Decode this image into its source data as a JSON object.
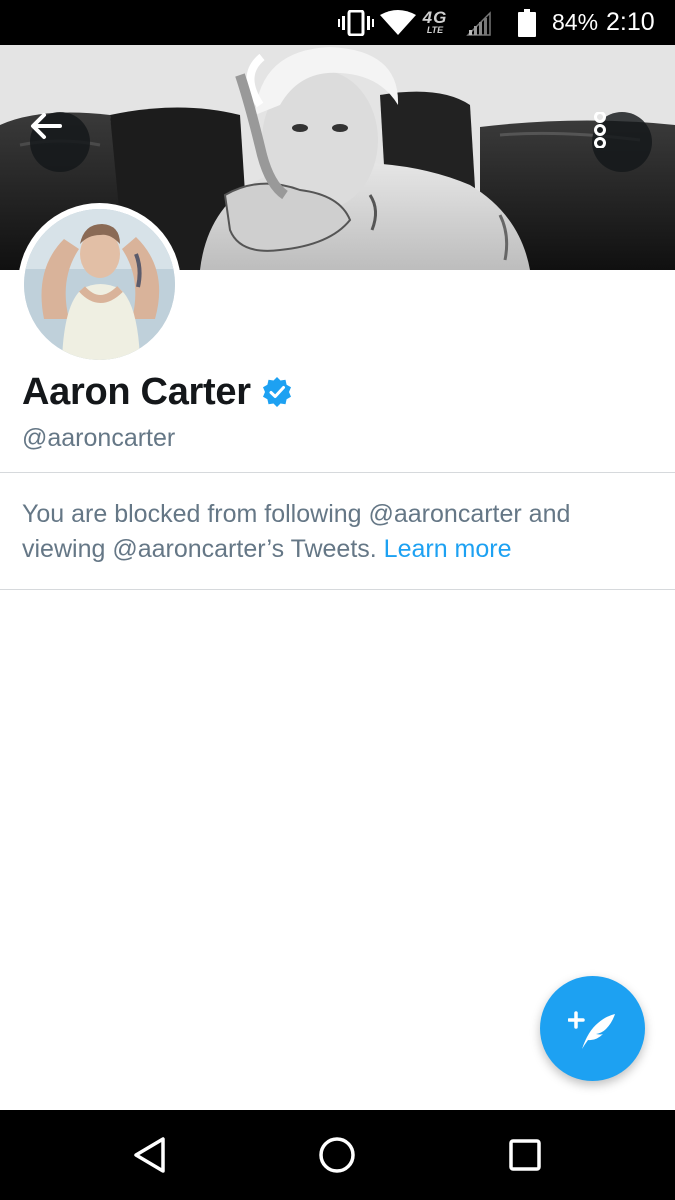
{
  "status_bar": {
    "network_type": "4G",
    "network_sub": "LTE",
    "battery_percent": "84%",
    "time": "2:10",
    "icons": [
      "vibrate-icon",
      "wifi-icon",
      "signal-icon",
      "battery-icon"
    ]
  },
  "header": {
    "back_icon": "arrow-left-icon",
    "more_icon": "more-vertical-icon"
  },
  "profile": {
    "display_name": "Aaron Carter",
    "verified": true,
    "username": "@aaroncarter"
  },
  "blocked_notice": {
    "message": "You are blocked from following @aaroncarter and viewing @aaroncarter’s Tweets. ",
    "link_label": "Learn more"
  },
  "fab": {
    "icon": "compose-tweet-icon"
  },
  "nav_bar": {
    "icons": [
      "nav-back-icon",
      "nav-home-icon",
      "nav-recents-icon"
    ]
  },
  "colors": {
    "accent": "#1da1f2",
    "secondary_text": "#657786",
    "primary_text": "#14171a",
    "divider": "#d6d9dc"
  }
}
